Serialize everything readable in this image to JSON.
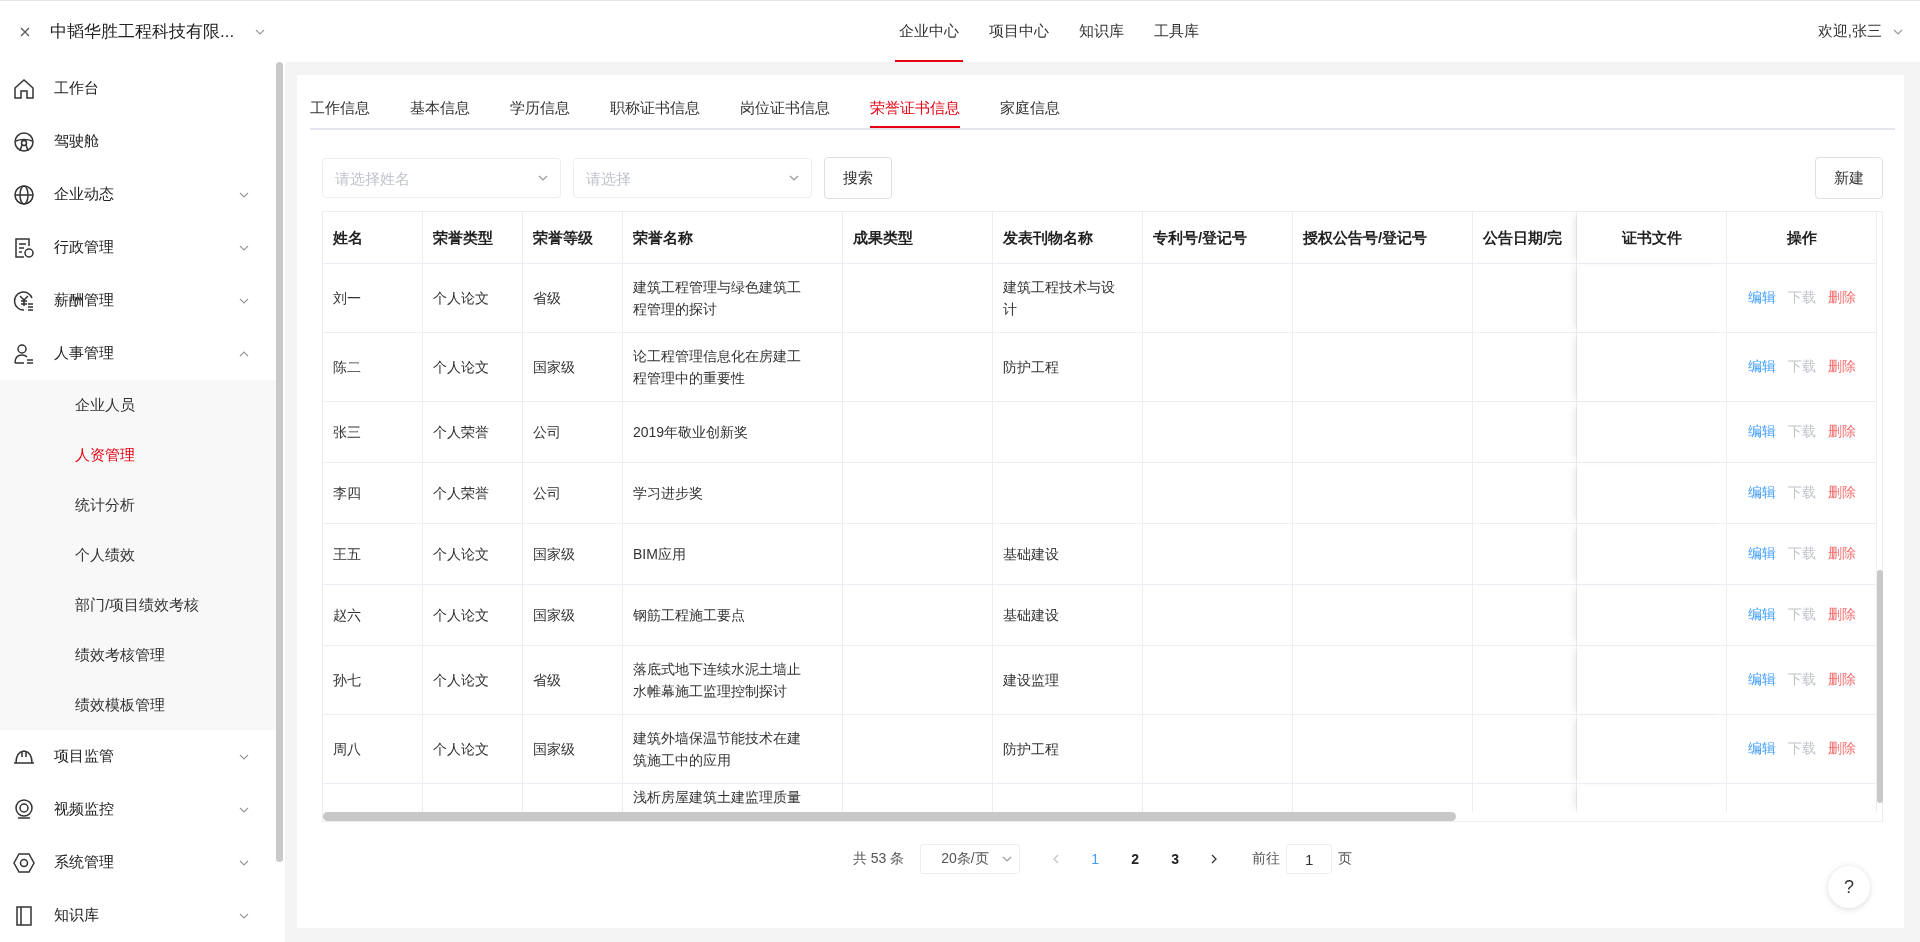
{
  "header": {
    "company": "中韬华胜工程科技有限...",
    "nav": [
      {
        "label": "企业中心",
        "selected": true
      },
      {
        "label": "项目中心",
        "selected": false
      },
      {
        "label": "知识库",
        "selected": false
      },
      {
        "label": "工具库",
        "selected": false
      }
    ],
    "user": "欢迎,张三"
  },
  "sidebar": {
    "items": [
      {
        "label": "工作台",
        "kind": "link"
      },
      {
        "label": "驾驶舱",
        "kind": "link"
      },
      {
        "label": "企业动态",
        "kind": "group",
        "expanded": false
      },
      {
        "label": "行政管理",
        "kind": "group",
        "expanded": false
      },
      {
        "label": "薪酬管理",
        "kind": "group",
        "expanded": false
      },
      {
        "label": "人事管理",
        "kind": "group",
        "expanded": true,
        "children": [
          {
            "label": "企业人员",
            "selected": false
          },
          {
            "label": "人资管理",
            "selected": true
          },
          {
            "label": "统计分析",
            "selected": false
          },
          {
            "label": "个人绩效",
            "selected": false
          },
          {
            "label": "部门/项目绩效考核",
            "selected": false
          },
          {
            "label": "绩效考核管理",
            "selected": false
          },
          {
            "label": "绩效模板管理",
            "selected": false
          }
        ]
      },
      {
        "label": "项目监管",
        "kind": "group",
        "expanded": false
      },
      {
        "label": "视频监控",
        "kind": "group",
        "expanded": false
      },
      {
        "label": "系统管理",
        "kind": "group",
        "expanded": false
      },
      {
        "label": "知识库",
        "kind": "group",
        "expanded": false
      }
    ]
  },
  "tabs": [
    {
      "label": "工作信息",
      "selected": false
    },
    {
      "label": "基本信息",
      "selected": false
    },
    {
      "label": "学历信息",
      "selected": false
    },
    {
      "label": "职称证书信息",
      "selected": false
    },
    {
      "label": "岗位证书信息",
      "selected": false
    },
    {
      "label": "荣誉证书信息",
      "selected": true
    },
    {
      "label": "家庭信息",
      "selected": false
    }
  ],
  "filters": [
    {
      "placeholder": "请选择姓名"
    },
    {
      "placeholder": "请选择"
    }
  ],
  "search_button": "搜索",
  "new_button": "新建",
  "table": {
    "columns": [
      "姓名",
      "荣誉类型",
      "荣誉等级",
      "荣誉名称",
      "成果类型",
      "发表刊物名称",
      "专利号/登记号",
      "授权公告号/登记号",
      "公告日期/完",
      "证书文件",
      "操作"
    ],
    "rows": [
      {
        "name": "刘一",
        "honor_type": "个人论文",
        "honor_level": "省级",
        "honor_name": "建筑工程管理与绿色建筑工程管理的探讨",
        "publication": "建筑工程技术与设计",
        "actions": [
          {
            "label": "编辑",
            "kind": "edit",
            "disabled": false
          },
          {
            "label": "下载",
            "disabled": true
          },
          {
            "label": "删除",
            "kind": "delete",
            "disabled": false
          }
        ]
      },
      {
        "name": "陈二",
        "honor_type": "个人论文",
        "honor_level": "国家级",
        "honor_name": "论工程管理信息化在房建工程管理中的重要性",
        "publication": "防护工程",
        "actions": [
          {
            "label": "编辑",
            "kind": "edit",
            "disabled": false
          },
          {
            "label": "下载",
            "disabled": true
          },
          {
            "label": "删除",
            "kind": "delete",
            "disabled": false
          }
        ]
      },
      {
        "name": "张三",
        "honor_type": "个人荣誉",
        "honor_level": "公司",
        "honor_name": "2019年敬业创新奖",
        "actions": [
          {
            "label": "编辑",
            "kind": "edit",
            "disabled": false
          },
          {
            "label": "下载",
            "disabled": true
          },
          {
            "label": "删除",
            "kind": "delete",
            "disabled": false
          }
        ]
      },
      {
        "name": "李四",
        "honor_type": "个人荣誉",
        "honor_level": "公司",
        "honor_name": "学习进步奖",
        "actions": [
          {
            "label": "编辑",
            "kind": "edit",
            "disabled": false
          },
          {
            "label": "下载",
            "disabled": true
          },
          {
            "label": "删除",
            "kind": "delete",
            "disabled": false
          }
        ]
      },
      {
        "name": "王五",
        "honor_type": "个人论文",
        "honor_level": "国家级",
        "honor_name": "BIM应用",
        "publication": "基础建设",
        "actions": [
          {
            "label": "编辑",
            "kind": "edit",
            "disabled": false
          },
          {
            "label": "下载",
            "disabled": true
          },
          {
            "label": "删除",
            "kind": "delete",
            "disabled": false
          }
        ]
      },
      {
        "name": "赵六",
        "honor_type": "个人论文",
        "honor_level": "国家级",
        "honor_name": "钢筋工程施工要点",
        "publication": "基础建设",
        "actions": [
          {
            "label": "编辑",
            "kind": "edit",
            "disabled": false
          },
          {
            "label": "下载",
            "disabled": true
          },
          {
            "label": "删除",
            "kind": "delete",
            "disabled": false
          }
        ]
      },
      {
        "name": "孙七",
        "honor_type": "个人论文",
        "honor_level": "省级",
        "honor_name": "落底式地下连续水泥土墙止水帷幕施工监理控制探讨",
        "publication": "建设监理",
        "actions": [
          {
            "label": "编辑",
            "kind": "edit",
            "disabled": false
          },
          {
            "label": "下载",
            "disabled": true
          },
          {
            "label": "删除",
            "kind": "delete",
            "disabled": false
          }
        ]
      },
      {
        "name": "周八",
        "honor_type": "个人论文",
        "honor_level": "国家级",
        "honor_name": "建筑外墙保温节能技术在建筑施工中的应用",
        "publication": "防护工程",
        "actions": [
          {
            "label": "编辑",
            "kind": "edit",
            "disabled": false
          },
          {
            "label": "下载",
            "disabled": true
          },
          {
            "label": "删除",
            "kind": "delete",
            "disabled": false
          }
        ]
      },
      {
        "honor_name": "浅析房屋建筑土建监理质量"
      }
    ]
  },
  "pagination": {
    "total": "共 53 条",
    "page_size": "20条/页",
    "pages": [
      {
        "label": "1",
        "selected": true
      },
      {
        "label": "2",
        "selected": false
      },
      {
        "label": "3",
        "selected": false
      }
    ],
    "goto_label": "前往",
    "goto_value": "1",
    "goto_suffix": "页"
  },
  "help_button": "?"
}
